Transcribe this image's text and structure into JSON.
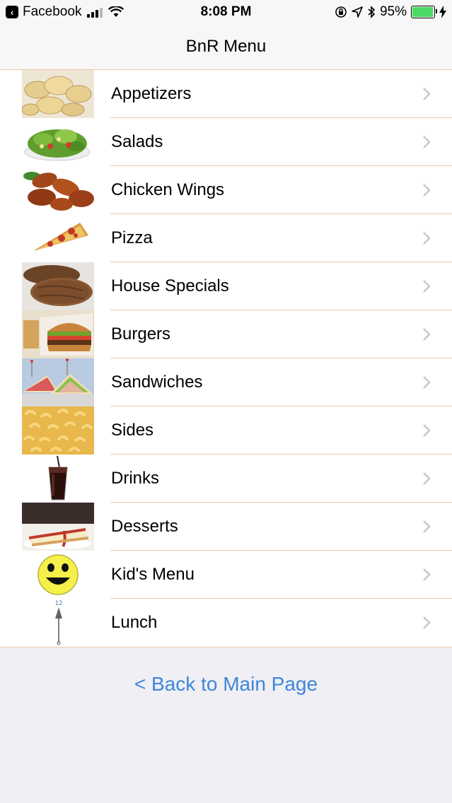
{
  "status_bar": {
    "back_app": "Facebook",
    "time": "8:08 PM",
    "battery_percent": "95%",
    "battery_level": 0.95
  },
  "nav": {
    "title": "BnR Menu"
  },
  "menu": {
    "items": [
      {
        "label": "Appetizers",
        "icon": "chips-image"
      },
      {
        "label": "Salads",
        "icon": "salad-image"
      },
      {
        "label": "Chicken Wings",
        "icon": "wings-image"
      },
      {
        "label": "Pizza",
        "icon": "pizza-slice-image"
      },
      {
        "label": "House Specials",
        "icon": "steak-image"
      },
      {
        "label": "Burgers",
        "icon": "burger-image"
      },
      {
        "label": "Sandwiches",
        "icon": "sandwich-image"
      },
      {
        "label": "Sides",
        "icon": "mac-and-cheese-image"
      },
      {
        "label": "Drinks",
        "icon": "soda-cup-image"
      },
      {
        "label": "Desserts",
        "icon": "cheesecake-image"
      },
      {
        "label": "Kid's Menu",
        "icon": "smiley-face-image"
      },
      {
        "label": "Lunch",
        "icon": "clock-hand-image",
        "icon_text": "12"
      }
    ]
  },
  "footer": {
    "back_label": "< Back to Main Page"
  },
  "colors": {
    "link": "#3f86d9",
    "separator": "#f0c8a8",
    "background": "#efeff4"
  }
}
